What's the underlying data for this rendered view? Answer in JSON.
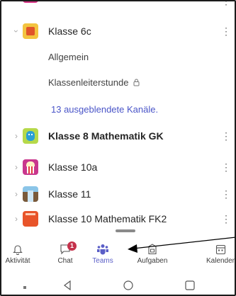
{
  "teams": [
    {
      "name": "Klasse 6c",
      "bold": false,
      "expanded": true,
      "icon": "orange-square-icon"
    },
    {
      "name": "Klasse 8 Mathematik GK",
      "bold": true,
      "expanded": false,
      "icon": "green-robot-icon"
    },
    {
      "name": "Klasse 10a",
      "bold": false,
      "expanded": false,
      "icon": "popcorn-icon"
    },
    {
      "name": "Klasse 11",
      "bold": false,
      "expanded": false,
      "icon": "landscape-icon"
    },
    {
      "name": "Klasse 10 Mathematik FK2",
      "bold": false,
      "expanded": false,
      "icon": "red-tile-icon"
    }
  ],
  "channels": {
    "general": "Allgemein",
    "homeroom": "Klassenleiterstunde",
    "hidden": "13 ausgeblendete Kanäle."
  },
  "nav": [
    {
      "label": "Aktivität",
      "icon": "bell-icon",
      "active": false
    },
    {
      "label": "Chat",
      "icon": "chat-icon",
      "active": false,
      "badge": "1"
    },
    {
      "label": "Teams",
      "icon": "teams-icon",
      "active": true
    },
    {
      "label": "Aufgaben",
      "icon": "assignments-icon",
      "active": false
    },
    {
      "label": "Kalender",
      "icon": "calendar-icon",
      "active": false
    }
  ],
  "colors": {
    "accent": "#5b5fc7",
    "link": "#4a55c8",
    "badge": "#c4314b"
  }
}
